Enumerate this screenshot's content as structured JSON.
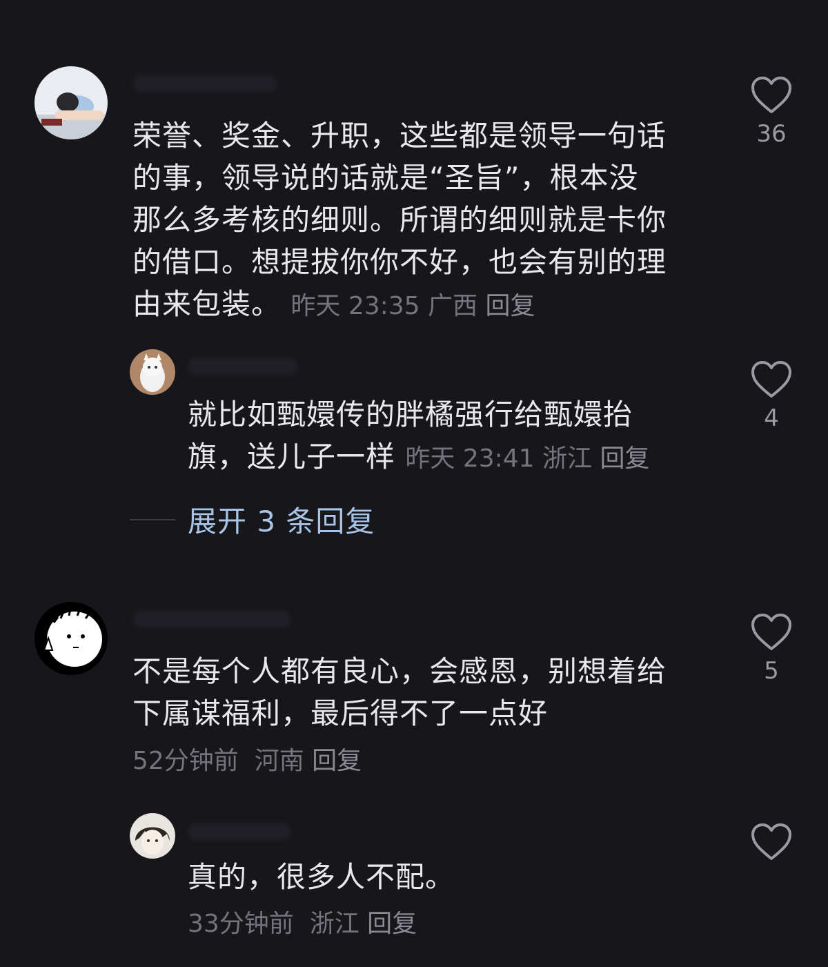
{
  "comments": [
    {
      "text": "荣誉、奖金、升职，这些都是领导一句话的事，领导说的话就是“圣旨”，根本没那么多考核的细则。所谓的细则就是卡你的借口。想提拔你你不好，也会有别的理由来包装。",
      "lines": [
        "荣誉、奖金、升职，这些都是领导一句话",
        "的事，领导说的话就是“圣旨”，根本没",
        "那么多考核的细则。所谓的细则就是卡你",
        "的借口。想提拔你你不好，也会有别的理",
        "由来包装。"
      ],
      "time": "昨天 23:35",
      "location": "广西",
      "reply_label": "回复",
      "likes": "36",
      "avatar_icon": "person-sleeping-on-desk-avatar"
    },
    {
      "lines": [
        "就比如甄嬛传的胖橘强行给甄嬛抬",
        "旗，送儿子一样"
      ],
      "time": "昨天 23:41",
      "location": "浙江",
      "reply_label": "回复",
      "likes": "4",
      "avatar_icon": "white-cat-avatar"
    },
    {
      "lines": [
        "不是每个人都有良心，会感恩，别想着给",
        "下属谋福利，最后得不了一点好"
      ],
      "time": "52分钟前",
      "location": "河南",
      "reply_label": "回复",
      "likes": "5",
      "avatar_icon": "cartoon-face-avatar"
    },
    {
      "lines": [
        "真的，很多人不配。"
      ],
      "time": "33分钟前",
      "location": "浙江",
      "reply_label": "回复",
      "likes": "",
      "avatar_icon": "anime-character-avatar"
    }
  ],
  "expand_replies": "展开 3 条回复",
  "colors": {
    "background": "#16161b",
    "text": "#e9e9ec",
    "meta": "#74747c",
    "link": "#a8c4e6"
  }
}
